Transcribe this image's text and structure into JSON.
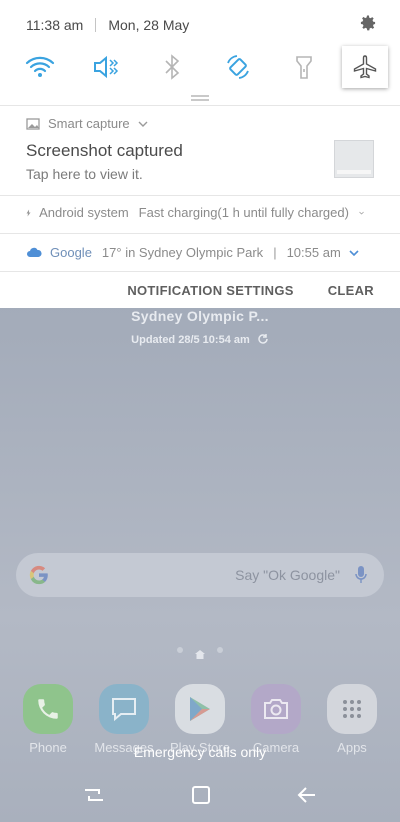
{
  "status": {
    "time": "11:38 am",
    "date": "Mon, 28 May"
  },
  "quick_settings": [
    {
      "name": "wifi-icon",
      "active": true
    },
    {
      "name": "sound-muted-icon",
      "active": true
    },
    {
      "name": "bluetooth-icon",
      "active": false
    },
    {
      "name": "auto-rotate-icon",
      "active": true
    },
    {
      "name": "flashlight-icon",
      "active": false
    },
    {
      "name": "airplane-mode-icon",
      "active": false
    }
  ],
  "notifications": {
    "smart_capture": {
      "app": "Smart capture",
      "title": "Screenshot captured",
      "text": "Tap here to view it."
    },
    "android_system": {
      "app": "Android system",
      "text": "Fast charging(1 h until fully charged)"
    },
    "google": {
      "app": "Google",
      "text": "17° in Sydney Olympic Park",
      "separator": "|",
      "time": "10:55 am"
    }
  },
  "actions": {
    "settings": "NOTIFICATION SETTINGS",
    "clear": "CLEAR"
  },
  "weather": {
    "location": "Sydney Olympic P...",
    "updated": "Updated 28/5 10:54 am"
  },
  "search": {
    "placeholder": "Say \"Ok Google\""
  },
  "dock": [
    {
      "label": "Phone",
      "color": "#8fc48c"
    },
    {
      "label": "Messages",
      "color": "#8ab3c9"
    },
    {
      "label": "Play Store",
      "color": "#d9dde2"
    },
    {
      "label": "Camera",
      "color": "#b3a8c8"
    },
    {
      "label": "Apps",
      "color": "#d3d6dc"
    }
  ],
  "emergency": "Emergency calls only",
  "colors": {
    "accent": "#3aa3e0",
    "inactive_icon": "#b5b5b5"
  }
}
